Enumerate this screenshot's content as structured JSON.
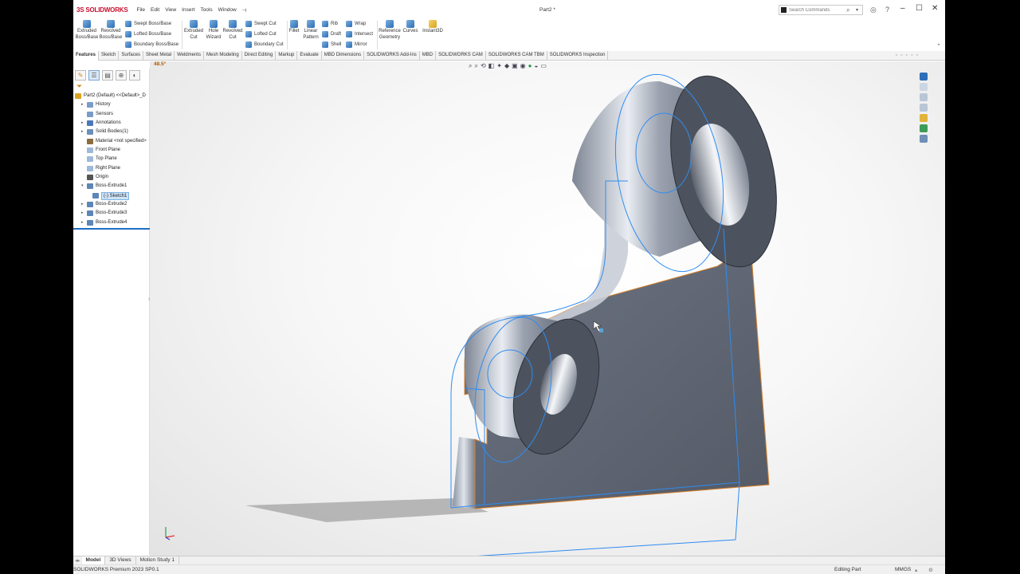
{
  "app": {
    "brand": "SOLIDWORKS",
    "brand_mark": "3S",
    "doc_title": "Part2 *"
  },
  "menu": [
    "File",
    "Edit",
    "View",
    "Insert",
    "Tools",
    "Window",
    "⊣"
  ],
  "search": {
    "placeholder": "Search Commands"
  },
  "commands": {
    "extruded_boss": "Extruded Boss/Base",
    "revolved_boss": "Revolved Boss/Base",
    "swept_boss": "Swept Boss/Base",
    "lofted_boss": "Lofted Boss/Base",
    "boundary_boss": "Boundary Boss/Base",
    "extruded_cut": "Extruded Cut",
    "hole_wizard": "Hole Wizard",
    "revolved_cut": "Revolved Cut",
    "swept_cut": "Swept Cut",
    "lofted_cut": "Lofted Cut",
    "boundary_cut": "Boundary Cut",
    "fillet": "Fillet",
    "linear_pattern": "Linear Pattern",
    "rib": "Rib",
    "draft": "Draft",
    "shell": "Shell",
    "wrap": "Wrap",
    "intersect": "Intersect",
    "mirror": "Mirror",
    "reference_geometry": "Reference Geometry",
    "curves": "Curves",
    "instant3d": "Instant3D"
  },
  "tabs": [
    "Features",
    "Sketch",
    "Surfaces",
    "Sheet Metal",
    "Weldments",
    "Mesh Modeling",
    "Direct Editing",
    "Markup",
    "Evaluate",
    "MBD Dimensions",
    "SOLIDWORKS Add-Ins",
    "MBD",
    "SOLIDWORKS CAM",
    "SOLIDWORKS CAM TBM",
    "SOLIDWORKS Inspection"
  ],
  "active_tab": "Features",
  "tree": [
    {
      "label": "Part2 (Default) <<Default>_D",
      "indent": 0,
      "toggle": "",
      "icon_color": "#d9a21f"
    },
    {
      "label": "History",
      "indent": 1,
      "toggle": "▸",
      "icon_color": "#7a9cc8"
    },
    {
      "label": "Sensors",
      "indent": 1,
      "toggle": "",
      "icon_color": "#7a9cc8"
    },
    {
      "label": "Annotations",
      "indent": 1,
      "toggle": "▸",
      "icon_color": "#4a78b8"
    },
    {
      "label": "Solid Bodies(1)",
      "indent": 1,
      "toggle": "▸",
      "icon_color": "#6c8fb8"
    },
    {
      "label": "Material <not specified>",
      "indent": 1,
      "toggle": "",
      "icon_color": "#8c6d3f"
    },
    {
      "label": "Front Plane",
      "indent": 1,
      "toggle": "",
      "icon_color": "#9fb9d8"
    },
    {
      "label": "Top Plane",
      "indent": 1,
      "toggle": "",
      "icon_color": "#9fb9d8"
    },
    {
      "label": "Right Plane",
      "indent": 1,
      "toggle": "",
      "icon_color": "#9fb9d8"
    },
    {
      "label": "Origin",
      "indent": 1,
      "toggle": "",
      "icon_color": "#555555"
    },
    {
      "label": "Boss-Extrude1",
      "indent": 1,
      "toggle": "▾",
      "icon_color": "#5d86b8"
    },
    {
      "label": "(-) Sketch1",
      "indent": 2,
      "toggle": "",
      "icon_color": "#5d86b8",
      "selected": true
    },
    {
      "label": "Boss-Extrude2",
      "indent": 1,
      "toggle": "▸",
      "icon_color": "#5d86b8"
    },
    {
      "label": "Boss-Extrude3",
      "indent": 1,
      "toggle": "▸",
      "icon_color": "#5d86b8"
    },
    {
      "label": "Boss-Extrude4",
      "indent": 1,
      "toggle": "▸",
      "icon_color": "#5d86b8"
    }
  ],
  "viewport": {
    "rotation_readout": "48.5°"
  },
  "bottom_tabs": [
    "Model",
    "3D Views",
    "Motion Study 1"
  ],
  "status": {
    "product": "SOLIDWORKS Premium 2023 SP0.1",
    "mode": "Editing Part",
    "units": "MMGS"
  },
  "colors": {
    "accent": "#1f6fc4",
    "selection": "#2f8cf0",
    "edge_highlight": "#e08a2c",
    "brand": "#c8102e"
  }
}
